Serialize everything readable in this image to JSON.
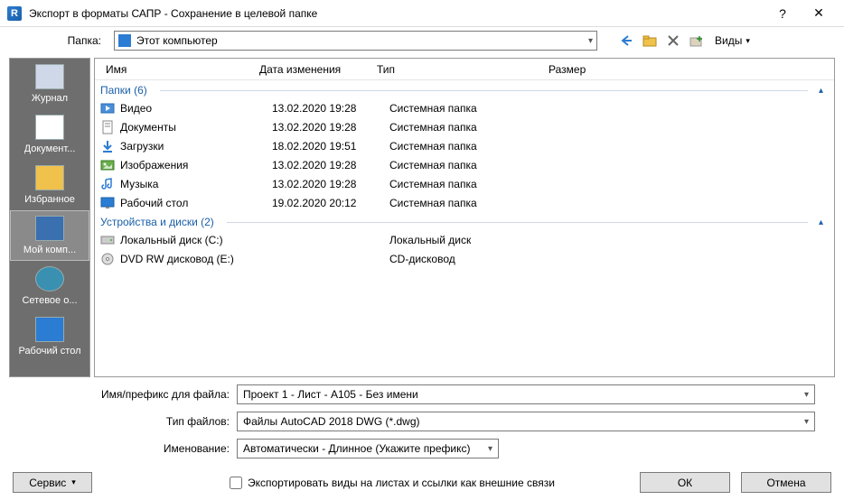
{
  "window": {
    "title": "Экспорт в форматы САПР - Сохранение в целевой папке"
  },
  "topbar": {
    "folder_label": "Папка:",
    "folder_value": "Этот компьютер",
    "views_label": "Виды"
  },
  "columns": {
    "name": "Имя",
    "date": "Дата изменения",
    "type": "Тип",
    "size": "Размер"
  },
  "groups": {
    "folders": {
      "label": "Папки (6)"
    },
    "devices": {
      "label": "Устройства и диски (2)"
    }
  },
  "folders": [
    {
      "icon": "video",
      "name": "Видео",
      "date": "13.02.2020 19:28",
      "type": "Системная папка"
    },
    {
      "icon": "doc",
      "name": "Документы",
      "date": "13.02.2020 19:28",
      "type": "Системная папка"
    },
    {
      "icon": "download",
      "name": "Загрузки",
      "date": "18.02.2020 19:51",
      "type": "Системная папка"
    },
    {
      "icon": "image",
      "name": "Изображения",
      "date": "13.02.2020 19:28",
      "type": "Системная папка"
    },
    {
      "icon": "music",
      "name": "Музыка",
      "date": "13.02.2020 19:28",
      "type": "Системная папка"
    },
    {
      "icon": "desktop",
      "name": "Рабочий стол",
      "date": "19.02.2020 20:12",
      "type": "Системная папка"
    }
  ],
  "devices": [
    {
      "icon": "hdd",
      "name": "Локальный диск (C:)",
      "date": "",
      "type": "Локальный диск"
    },
    {
      "icon": "dvd",
      "name": "DVD RW дисковод (E:)",
      "date": "",
      "type": "CD-дисковод"
    }
  ],
  "sidebar": [
    {
      "label": "Журнал"
    },
    {
      "label": "Документ..."
    },
    {
      "label": "Избранное"
    },
    {
      "label": "Мой комп..."
    },
    {
      "label": "Сетевое о..."
    },
    {
      "label": "Рабочий стол"
    }
  ],
  "fields": {
    "filename_prefix_label": "Имя/префикс для файла:",
    "filename_prefix_value": "Проект 1 - Лист - A105 - Без имени",
    "filetype_label": "Тип файлов:",
    "filetype_value": "Файлы AutoCAD 2018 DWG  (*.dwg)",
    "naming_label": "Именование:",
    "naming_value": "Автоматически - Длинное (Укажите префикс)"
  },
  "footer": {
    "service_label": "Сервис",
    "export_checkbox_label": "Экспортировать виды на листах и ссылки как внешние связи",
    "ok_label": "ОК",
    "cancel_label": "Отмена"
  }
}
